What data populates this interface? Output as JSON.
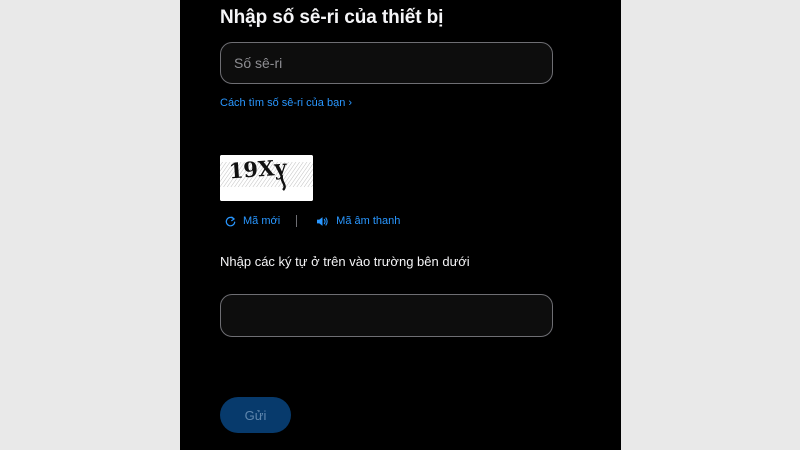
{
  "form": {
    "heading": "Nhập số sê-ri của thiết bị",
    "serial_placeholder": "Số sê-ri",
    "serial_value": "",
    "find_serial_link": "Cách tìm số sê-ri của bạn ›",
    "captcha": {
      "image_text": "19Xy",
      "new_code_label": "Mã mới",
      "audio_code_label": "Mã âm thanh",
      "instruction": "Nhập các ký tự ở trên vào trường bên dưới",
      "input_value": ""
    },
    "submit_label": "Gửi"
  },
  "colors": {
    "page_background": "#e9e9e9",
    "panel_background": "#000000",
    "text": "#f5f5f7",
    "link": "#2997ff",
    "field_border": "#6e6e73",
    "submit_background": "#073a6c",
    "submit_text": "#5f86ad"
  },
  "icons": {
    "new_code": "refresh-icon",
    "audio_code": "speaker-icon"
  }
}
